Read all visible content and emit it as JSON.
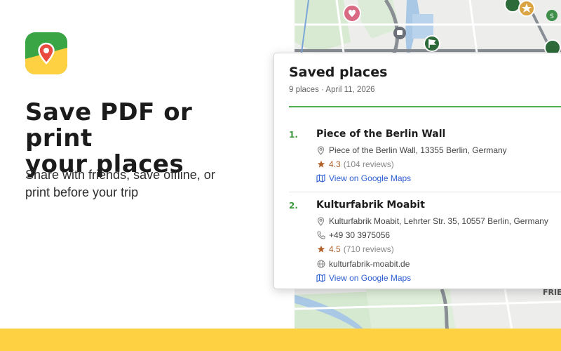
{
  "promo": {
    "headline_line1": "Save PDF or print",
    "headline_line2": "your places",
    "subline_line1": "Share with friends, save offline, or",
    "subline_line2": "print before your trip"
  },
  "map": {
    "labels": [
      "FRIE"
    ]
  },
  "card": {
    "title": "Saved places",
    "meta": "9 places · April 11, 2026",
    "places": [
      {
        "number": "1.",
        "name": "Piece of the Berlin Wall",
        "address": "Piece of the Berlin Wall, 13355 Berlin, Germany",
        "rating": "4.3",
        "reviews": "(104 reviews)",
        "link": "View on Google Maps"
      },
      {
        "number": "2.",
        "name": "Kulturfabrik Moabit",
        "address": "Kulturfabrik Moabit, Lehrter Str. 35, 10557 Berlin, Germany",
        "phone": "+49 30 3975056",
        "rating": "4.5",
        "reviews": "(710 reviews)",
        "website": "kulturfabrik-moabit.de",
        "link": "View on Google Maps"
      }
    ]
  },
  "colors": {
    "accent_green": "#4caf50",
    "band_yellow": "#fdd142",
    "link_blue": "#2f5fd0",
    "rating_brown": "#b0612a"
  }
}
